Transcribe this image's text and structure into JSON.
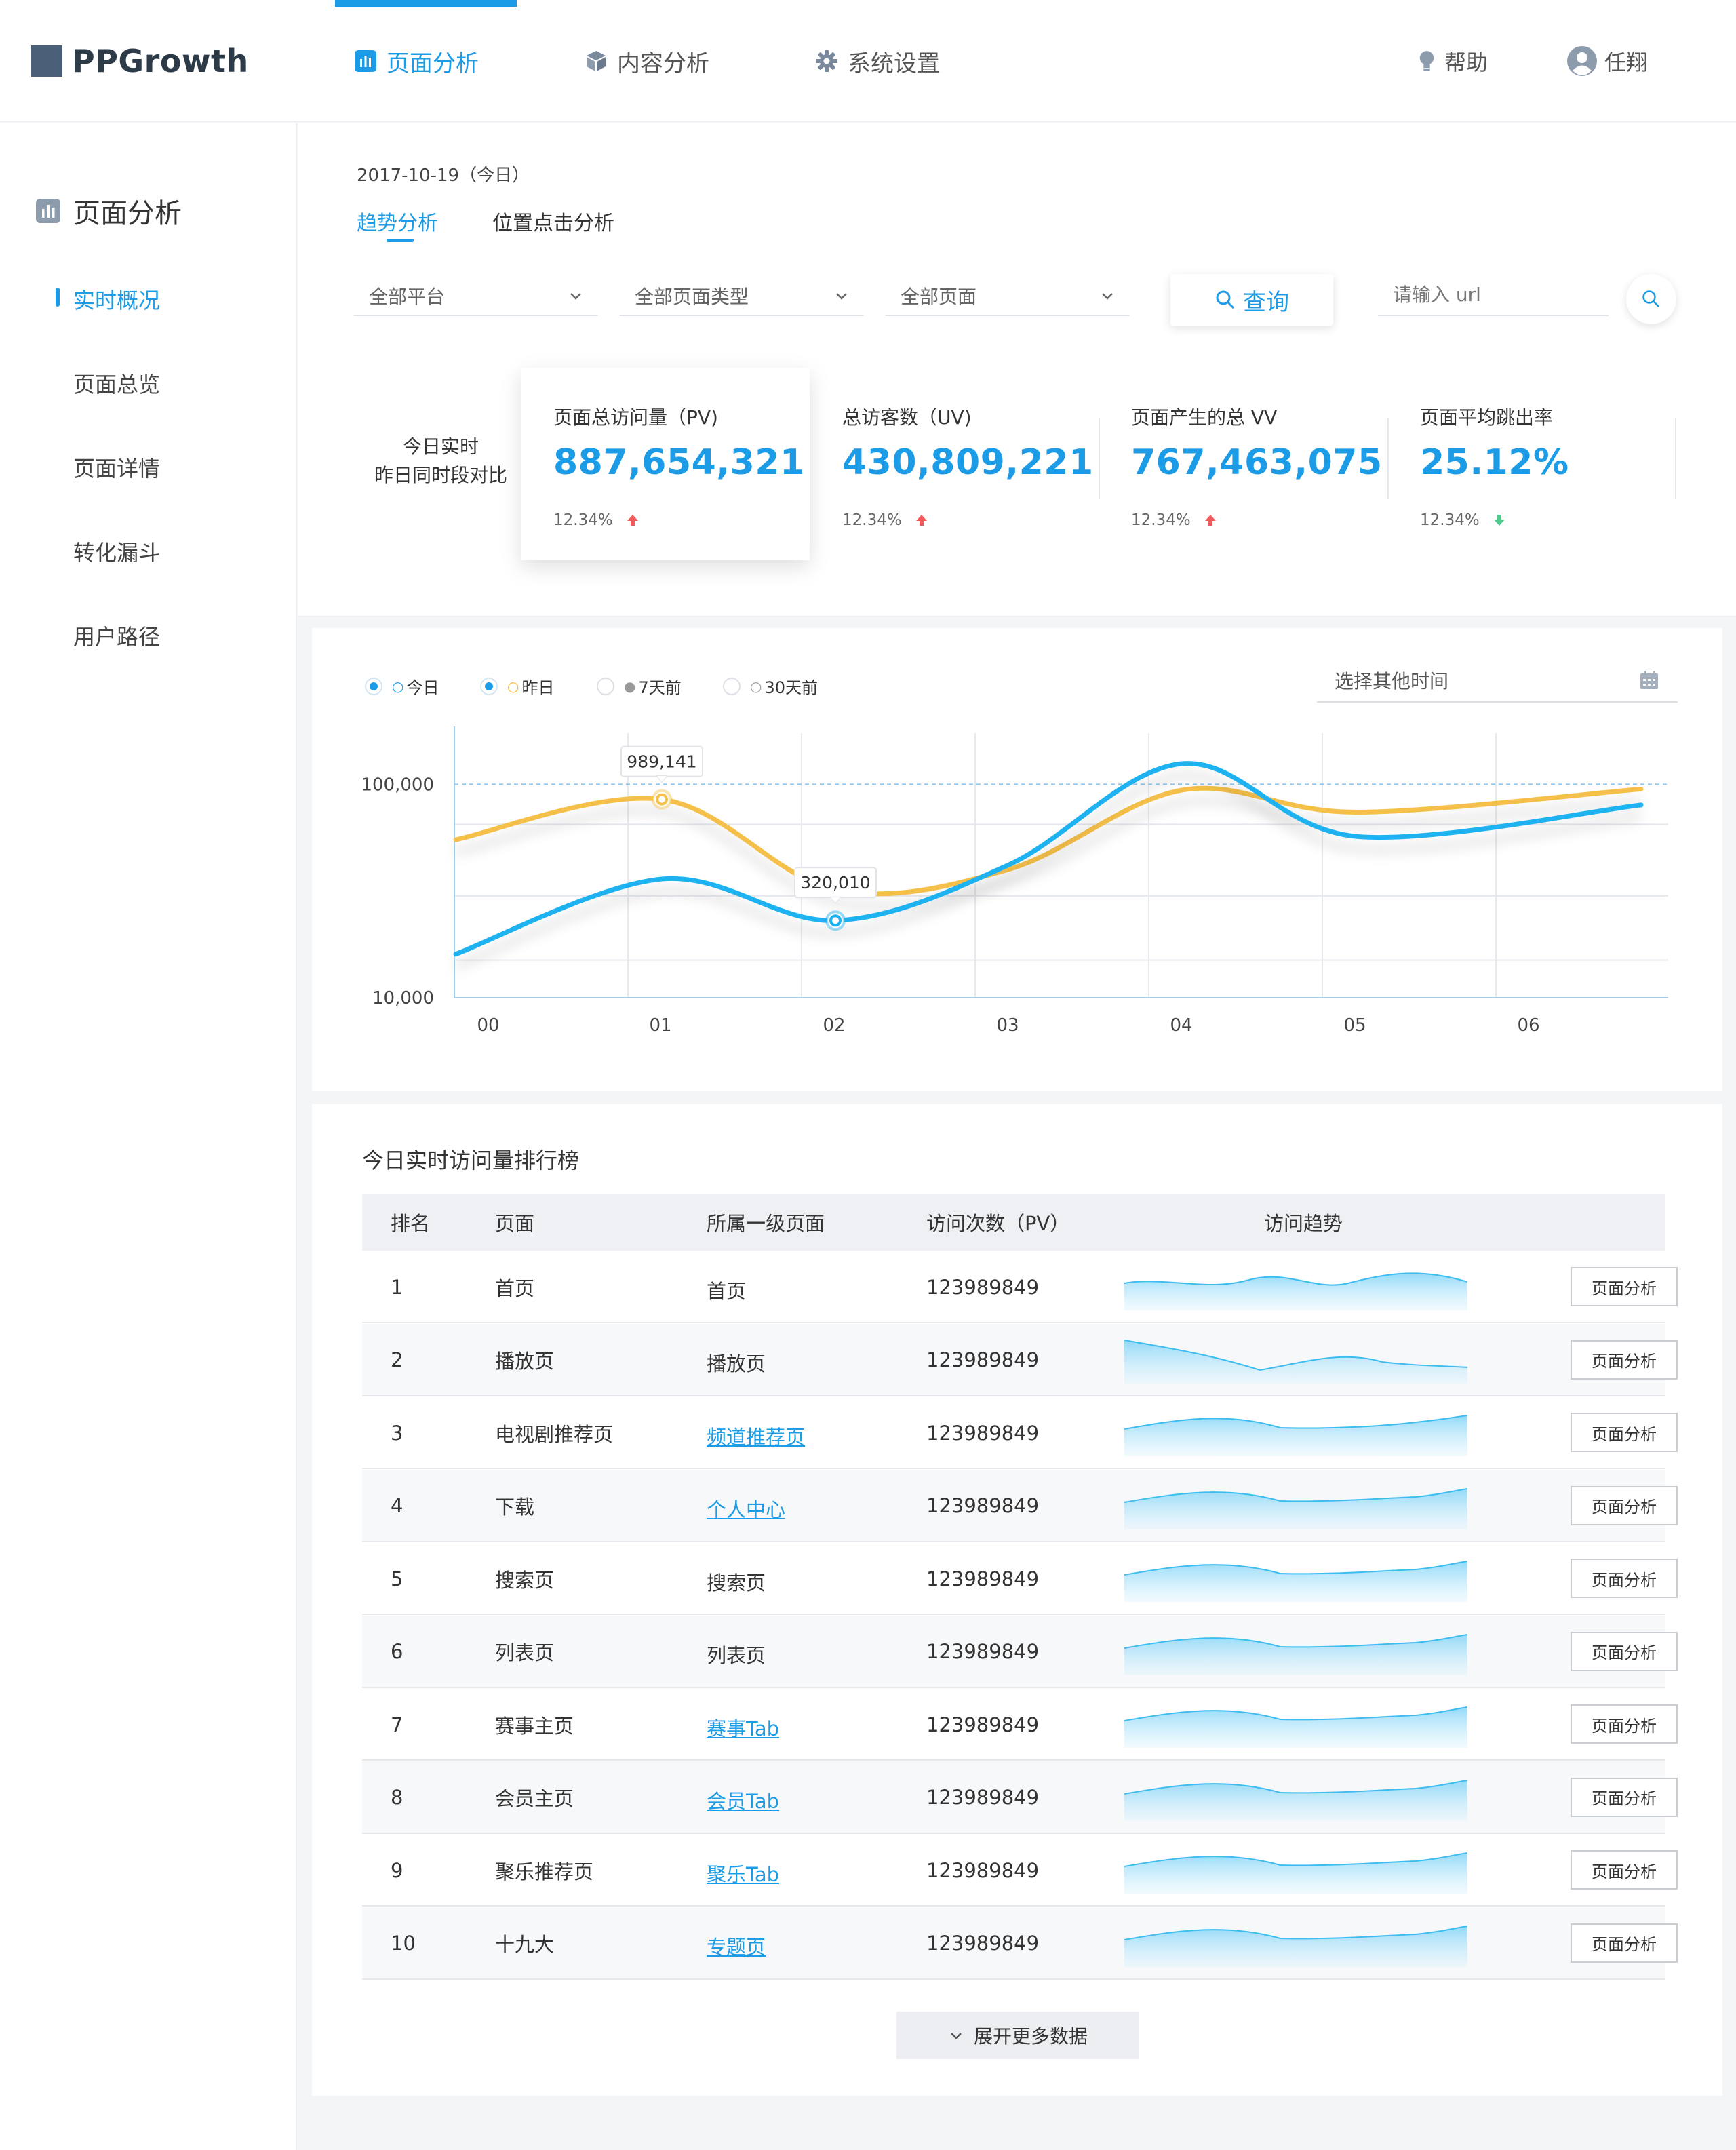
{
  "app": {
    "name": "PPGrowth",
    "brand_color": "#4a5f78",
    "accent": "#1c9be6"
  },
  "topnav": {
    "items": [
      {
        "label": "页面分析",
        "icon": "bar-chart-icon",
        "active": true
      },
      {
        "label": "内容分析",
        "icon": "cube-icon",
        "active": false
      },
      {
        "label": "系统设置",
        "icon": "gear-icon",
        "active": false
      }
    ],
    "help": {
      "label": "帮助",
      "icon": "bulb-icon"
    },
    "user": {
      "label": "任翔",
      "icon": "user-avatar-icon"
    }
  },
  "sidebar": {
    "title": "页面分析",
    "items": [
      {
        "label": "实时概况",
        "active": true
      },
      {
        "label": "页面总览"
      },
      {
        "label": "页面详情"
      },
      {
        "label": "转化漏斗"
      },
      {
        "label": "用户路径"
      }
    ]
  },
  "header": {
    "date": "2017-10-19（今日）",
    "tabs": [
      {
        "label": "趋势分析",
        "active": true
      },
      {
        "label": "位置点击分析"
      }
    ]
  },
  "filters": {
    "platform": "全部平台",
    "page_type": "全部页面类型",
    "page": "全部页面",
    "query_label": "查询",
    "url_placeholder": "请输入 url"
  },
  "kpis": {
    "compare_label_1": "今日实时",
    "compare_label_2": "昨日同时段对比",
    "items": [
      {
        "label": "页面总访问量（PV)",
        "value": "887,654,321",
        "delta": "12.34%",
        "trend": "up"
      },
      {
        "label": "总访客数（UV)",
        "value": "430,809,221",
        "delta": "12.34%",
        "trend": "up"
      },
      {
        "label": "页面产生的总 VV",
        "value": "767,463,075",
        "delta": "12.34%",
        "trend": "up"
      },
      {
        "label": "页面平均跳出率",
        "value": "25.12%",
        "delta": "12.34%",
        "trend": "down"
      }
    ],
    "up_color": "#f05a5a",
    "down_color": "#4fc98c"
  },
  "legend": {
    "items": [
      {
        "label": "今日",
        "marker": "○",
        "checked": true,
        "color": "#1c9be6"
      },
      {
        "label": "昨日",
        "marker": "○",
        "checked": true,
        "color": "#f5b73b"
      },
      {
        "label": "7天前",
        "marker": "●",
        "checked": false,
        "color": "#999999"
      },
      {
        "label": "30天前",
        "marker": "○",
        "checked": false,
        "color": "#999999"
      }
    ],
    "time_placeholder": "选择其他时间"
  },
  "chart_data": {
    "type": "line",
    "x": [
      "00",
      "01",
      "02",
      "03",
      "04",
      "05",
      "06"
    ],
    "y_ticks": [
      "100,000",
      "10,000"
    ],
    "y_scale": "log",
    "ylim": [
      10000,
      150000
    ],
    "series": [
      {
        "name": "今日",
        "color": "#1fb2f0",
        "values": [
          16000,
          36000,
          23000,
          42000,
          125000,
          57000,
          80000
        ]
      },
      {
        "name": "昨日",
        "color": "#f5c04a",
        "values": [
          55000,
          85000,
          32000,
          40000,
          94000,
          74000,
          95000
        ]
      }
    ],
    "annotations": [
      {
        "series": "昨日",
        "x": "01",
        "label": "989,141"
      },
      {
        "series": "今日",
        "x": "02",
        "label": "320,010"
      }
    ],
    "grid": true
  },
  "ranking": {
    "title": "今日实时访问量排行榜",
    "columns": [
      "排名",
      "页面",
      "所属一级页面",
      "访问次数（PV）",
      "访问趋势"
    ],
    "action_label": "页面分析",
    "more_label": "展开更多数据",
    "rows": [
      {
        "rank": "1",
        "page": "首页",
        "parent": "首页",
        "parent_link": false,
        "pv": "123989849"
      },
      {
        "rank": "2",
        "page": "播放页",
        "parent": "播放页",
        "parent_link": false,
        "pv": "123989849"
      },
      {
        "rank": "3",
        "page": "电视剧推荐页",
        "parent": "频道推荐页",
        "parent_link": true,
        "pv": "123989849"
      },
      {
        "rank": "4",
        "page": "下载",
        "parent": "个人中心",
        "parent_link": true,
        "pv": "123989849"
      },
      {
        "rank": "5",
        "page": "搜索页",
        "parent": "搜索页",
        "parent_link": false,
        "pv": "123989849"
      },
      {
        "rank": "6",
        "page": "列表页",
        "parent": "列表页",
        "parent_link": false,
        "pv": "123989849"
      },
      {
        "rank": "7",
        "page": "赛事主页",
        "parent": "赛事Tab",
        "parent_link": true,
        "pv": "123989849"
      },
      {
        "rank": "8",
        "page": "会员主页",
        "parent": "会员Tab",
        "parent_link": true,
        "pv": "123989849"
      },
      {
        "rank": "9",
        "page": "聚乐推荐页",
        "parent": "聚乐Tab",
        "parent_link": true,
        "pv": "123989849"
      },
      {
        "rank": "10",
        "page": "十九大",
        "parent": "专题页",
        "parent_link": true,
        "pv": "123989849"
      }
    ]
  }
}
